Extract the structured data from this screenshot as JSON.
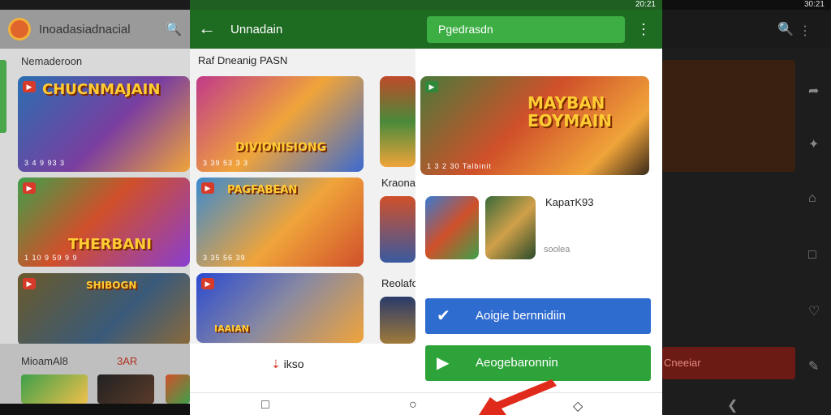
{
  "panel1": {
    "app_title": "Inoadasiadnacial",
    "section_title": "Nemaderoon",
    "cards": [
      {
        "title": "CHUCNMAJAIN",
        "caption": "3 4 9 93 3"
      },
      {
        "title": "THERBANI",
        "caption": "1 10 9 59 9 9"
      },
      {
        "title": "SHIBOGN",
        "caption": ""
      }
    ],
    "sheet_label": "MioamAl8",
    "sheet_label_red": "3AR"
  },
  "panel2": {
    "title": "Unnadain",
    "section_title": "Raf Dneanig PASN",
    "cards": [
      {
        "title": "DIVIONISIONG",
        "caption": "3 39 53 3 3"
      },
      {
        "title": "PAGFABEAN",
        "caption": "3 35 56 39"
      },
      {
        "title": "IAAIAN",
        "caption": ""
      }
    ],
    "side_section_2": "Kraonan",
    "side_section_3": "Reolafor",
    "footer_prefix": "⇣",
    "footer_label": "ikso"
  },
  "panel3": {
    "status_time": "20:21",
    "search_pill": "Pgedrasdn",
    "hero_title": "MAYBAN EOYMAIN",
    "hero_caption": "1 3 2 30 Talbinit",
    "desc_title": "KapaтK93",
    "desc_sub": "soolea",
    "primary_button": "Aoigie bernnidiin",
    "secondary_button": "Aeogebaronnin"
  },
  "panel4": {
    "status_time": "30:21",
    "red_label": "Cneeiar"
  },
  "nav": {
    "recent": "□",
    "home": "○",
    "back": "◇"
  },
  "colors": {
    "green_dark": "#1e6b22",
    "green_button": "#3cae44",
    "blue_button": "#2f6cd0",
    "green_cta": "#2ea33a",
    "arrow_red": "#e02a1c"
  }
}
